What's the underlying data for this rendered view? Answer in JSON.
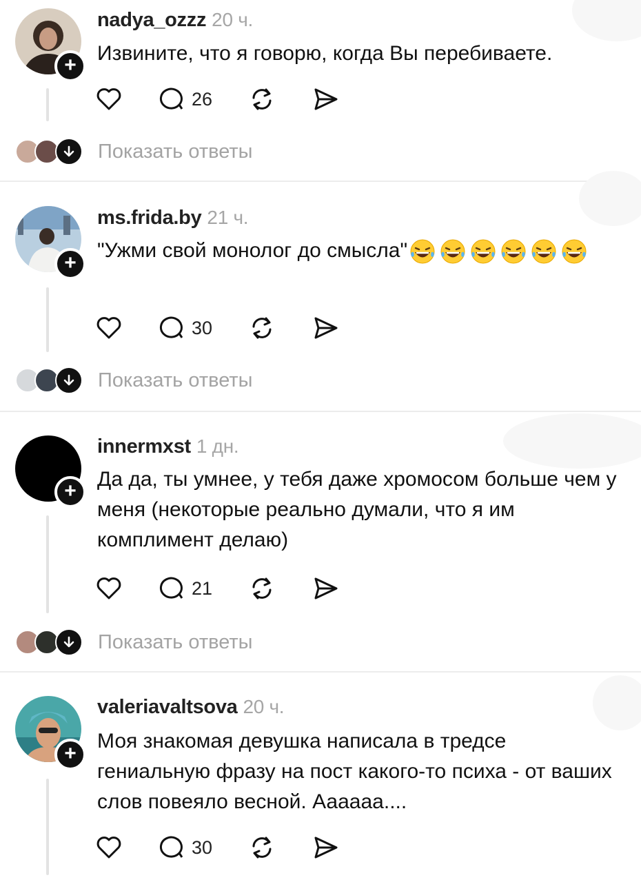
{
  "posts": [
    {
      "username": "nadya_ozzz",
      "time": "20 ч.",
      "text": "Извините, что я говорю, когда Вы перебиваете.",
      "replies_count": "26",
      "show_replies": "Показать ответы"
    },
    {
      "username": "ms.frida.by",
      "time": "21 ч.",
      "text": "\"Ужми свой монолог до смысла\"",
      "emoji": "😂😂😂😂😂😂",
      "replies_count": "30",
      "show_replies": "Показать ответы"
    },
    {
      "username": "innermxst",
      "time": "1 дн.",
      "text": "Да да, ты умнее, у тебя даже хромосом больше чем у меня (некоторые реально думали, что я им комплимент делаю)",
      "replies_count": "21",
      "show_replies": "Показать ответы"
    },
    {
      "username": "valeriavaltsova",
      "time": "20 ч.",
      "text": "Моя знакомая девушка написала в тредсе гениальную фразу на пост какого-то психа - от ваших слов повеяло весной. Аааааа....",
      "replies_count": "30"
    }
  ],
  "icons": {
    "like": "heart-icon",
    "reply": "speech-bubble-icon",
    "repost": "repost-icon",
    "share": "send-icon",
    "follow": "plus-icon",
    "expand": "arrow-down-icon"
  },
  "colors": {
    "text": "#111111",
    "muted": "#a6a6a6",
    "divider": "#ececec",
    "badge": "#111111"
  }
}
